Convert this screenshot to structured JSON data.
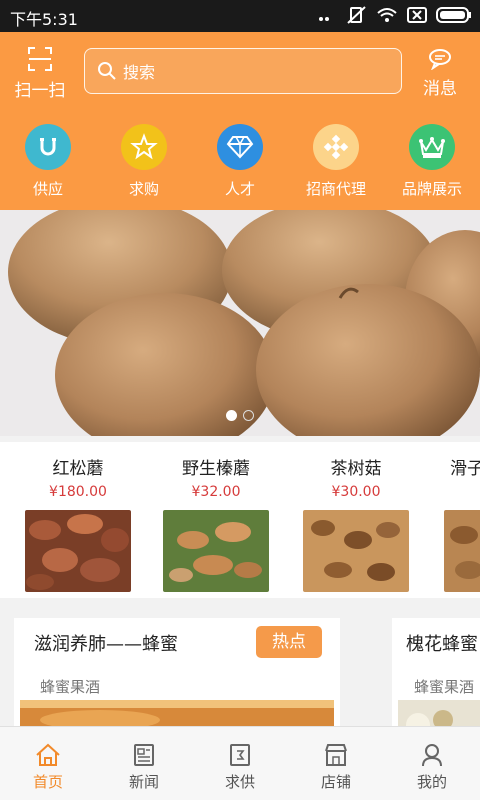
{
  "status": {
    "time": "下午5:31"
  },
  "header": {
    "scan_label": "扫一扫",
    "search_placeholder": "搜索",
    "message_label": "消息"
  },
  "categories": [
    {
      "label": "供应",
      "icon": "u-magnet-icon",
      "color": "#3fb8cf"
    },
    {
      "label": "求购",
      "icon": "star-icon",
      "color": "#f2c21a"
    },
    {
      "label": "人才",
      "icon": "diamond-icon",
      "color": "#2e8fe0"
    },
    {
      "label": "招商代理",
      "icon": "diamond-dots-icon",
      "color": "#fcd48a"
    },
    {
      "label": "品牌展示",
      "icon": "crown-icon",
      "color": "#3cc374"
    }
  ],
  "banner": {
    "slide_count": 2,
    "active_slide": 1
  },
  "products": [
    {
      "name": "红松蘑",
      "price": "¥180.00"
    },
    {
      "name": "野生榛蘑",
      "price": "¥32.00"
    },
    {
      "name": "茶树菇",
      "price": "¥30.00"
    },
    {
      "name": "滑子",
      "price": ""
    }
  ],
  "cards": [
    {
      "title": "滋润养肺——蜂蜜",
      "subtitle": "蜂蜜果酒",
      "badge": "热点"
    },
    {
      "title": "槐花蜂蜜",
      "subtitle": "蜂蜜果酒",
      "badge": ""
    }
  ],
  "tabs": [
    {
      "label": "首页",
      "icon": "home-icon",
      "active": true
    },
    {
      "label": "新闻",
      "icon": "news-icon",
      "active": false
    },
    {
      "label": "求供",
      "icon": "supply-icon",
      "active": false
    },
    {
      "label": "店铺",
      "icon": "shop-icon",
      "active": false
    },
    {
      "label": "我的",
      "icon": "user-icon",
      "active": false
    }
  ],
  "colors": {
    "accent": "#fb9a43",
    "price": "#d63b3b",
    "tab_active": "#f28a2a"
  }
}
